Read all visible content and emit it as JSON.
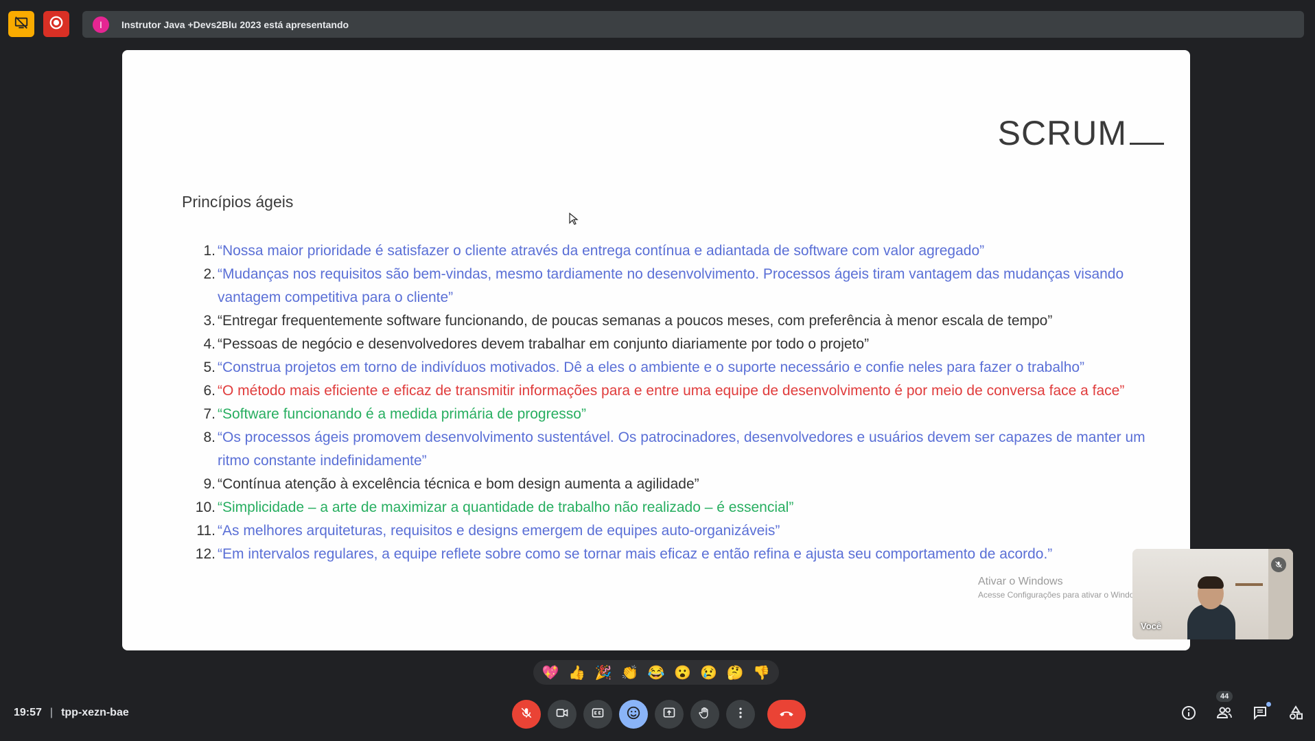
{
  "banner": {
    "avatar_letter": "I",
    "presenting_text": "Instrutor Java +Devs2Blu 2023 está apresentando"
  },
  "slide": {
    "title": "SCRUM",
    "subtitle": "Princípios ágeis",
    "items": [
      {
        "num": "1.",
        "text": "“Nossa maior prioridade é satisfazer o cliente através da entrega contínua e adiantada de software com valor agregado”",
        "color": "#5a6fd6"
      },
      {
        "num": "2.",
        "text": "“Mudanças nos requisitos são bem-vindas, mesmo tardiamente no desenvolvimento. Processos ágeis tiram vantagem das mudanças visando vantagem competitiva para o cliente”",
        "color": "#5a6fd6"
      },
      {
        "num": "3.",
        "text": "“Entregar frequentemente software funcionando, de poucas semanas a poucos meses, com preferência à menor escala de tempo”",
        "color": "#333333"
      },
      {
        "num": "4.",
        "text": "“Pessoas de negócio e desenvolvedores devem trabalhar em conjunto diariamente por todo o projeto”",
        "color": "#333333"
      },
      {
        "num": "5.",
        "text": "“Construa projetos em torno de indivíduos motivados. Dê a eles o ambiente e o suporte necessário e confie neles para fazer o trabalho”",
        "color": "#5a6fd6"
      },
      {
        "num": "6.",
        "text": "“O método mais eficiente e eficaz de transmitir informações para e entre uma equipe de desenvolvimento é por meio de conversa face a face”",
        "color": "#e03c3c"
      },
      {
        "num": "7.",
        "text": "“Software funcionando é a medida primária de progresso”",
        "color": "#27ae60"
      },
      {
        "num": "8.",
        "text": "“Os processos ágeis promovem desenvolvimento sustentável. Os patrocinadores, desenvolvedores e usuários devem ser capazes de manter um ritmo constante indefinidamente”",
        "color": "#5a6fd6"
      },
      {
        "num": "9.",
        "text": "“Contínua atenção à excelência técnica e bom design aumenta a agilidade”",
        "color": "#333333"
      },
      {
        "num": "10.",
        "text": "“Simplicidade – a arte de maximizar a quantidade de trabalho não realizado – é essencial”",
        "color": "#27ae60"
      },
      {
        "num": "11.",
        "text": "“As melhores arquiteturas, requisitos e designs emergem de equipes auto-organizáveis”",
        "color": "#5a6fd6"
      },
      {
        "num": "12.",
        "text": "“Em intervalos regulares, a equipe reflete sobre como se tornar mais eficaz e então refina e ajusta seu comportamento de acordo.”",
        "color": "#5a6fd6"
      }
    ],
    "watermark_title": "Ativar o Windows",
    "watermark_sub": "Acesse Configurações para ativar o Windows."
  },
  "self_view": {
    "label": "Você"
  },
  "reactions": [
    "💖",
    "👍",
    "🎉",
    "👏",
    "😂",
    "😮",
    "😢",
    "🤔",
    "👎"
  ],
  "footer": {
    "time": "19:57",
    "meeting_code": "tpp-xezn-bae",
    "participants_count": "44"
  },
  "colors": {
    "accent_blue": "#8ab4f8",
    "danger_red": "#ea4335",
    "present_yellow": "#f9ab00"
  }
}
